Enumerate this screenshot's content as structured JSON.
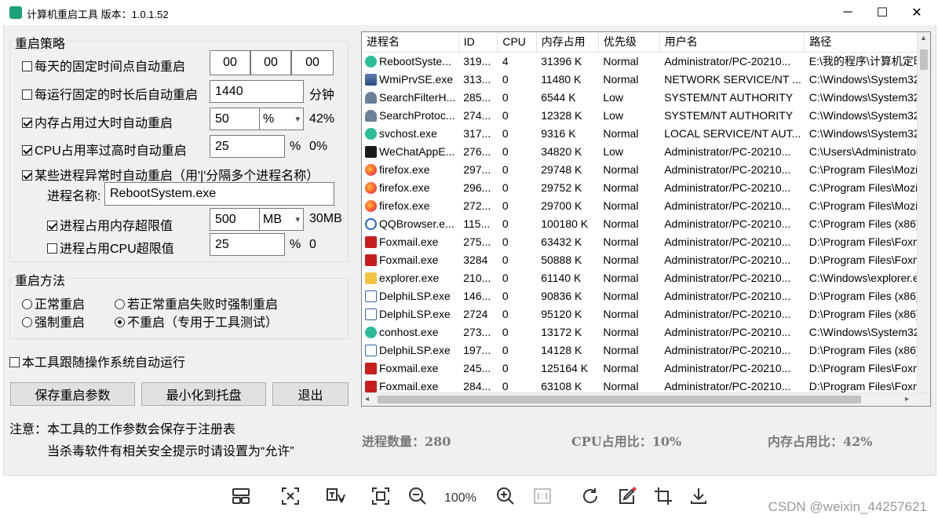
{
  "window": {
    "title": "计算机重启工具 版本：1.0.1.52",
    "minimize": "─",
    "maximize": "☐",
    "close": "✕"
  },
  "strategy": {
    "title": "重启策略",
    "fixed_time": {
      "label": "每天的固定时间点自动重启",
      "checked": false,
      "h": "00",
      "m": "00",
      "s": "00"
    },
    "run_duration": {
      "label": "每运行固定的时长后自动重启",
      "checked": false,
      "value": "1440",
      "unit": "分钟"
    },
    "memory": {
      "label": "内存占用过大时自动重启",
      "checked": true,
      "value": "50",
      "unit": "%",
      "current": "42%"
    },
    "cpu": {
      "label": "CPU占用率过高时自动重启",
      "checked": true,
      "value": "25",
      "unit": "%",
      "current": "0%"
    },
    "process": {
      "label": "某些进程异常时自动重启（用'|'分隔多个进程名称）",
      "checked": true,
      "name_label": "进程名称:",
      "name_value": "RebootSystem.exe",
      "mem_limit": {
        "label": "进程占用内存超限值",
        "checked": true,
        "value": "500",
        "unit": "MB",
        "current": "30MB"
      },
      "cpu_limit": {
        "label": "进程占用CPU超限值",
        "checked": false,
        "value": "25",
        "unit": "%",
        "current": "0"
      }
    }
  },
  "method": {
    "title": "重启方法",
    "normal": "正常重启",
    "force_if_fail": "若正常重启失败时强制重启",
    "force": "强制重启",
    "no_restart": "不重启（专用于工具测试）",
    "selected": "no_restart"
  },
  "autostart": {
    "label": "本工具跟随操作系统自动运行",
    "checked": false
  },
  "buttons": {
    "save": "保存重启参数",
    "minimize_tray": "最小化到托盘",
    "exit": "退出"
  },
  "notes": {
    "line1": "注意：本工具的工作参数会保存于注册表",
    "line2": "当杀毒软件有相关安全提示时请设置为“允许”"
  },
  "table": {
    "columns": [
      "进程名",
      "ID",
      "CPU",
      "内存占用",
      "优先级",
      "用户名",
      "路径"
    ],
    "rows": [
      {
        "icon": "green",
        "name": "RebootSyste...",
        "id": "319...",
        "cpu": "4",
        "mem": "31396 K",
        "prio": "Normal",
        "user": "Administrator/PC-20210...",
        "path": "E:\\我的程序\\计算机定时"
      },
      {
        "icon": "wmi",
        "name": "WmiPrvSE.exe",
        "id": "313...",
        "cpu": "0",
        "mem": "11480 K",
        "prio": "Normal",
        "user": "NETWORK SERVICE/NT ...",
        "path": "C:\\Windows\\System32"
      },
      {
        "icon": "person",
        "name": "SearchFilterH...",
        "id": "285...",
        "cpu": "0",
        "mem": "6544 K",
        "prio": "Low",
        "user": "SYSTEM/NT AUTHORITY",
        "path": "C:\\Windows\\System32"
      },
      {
        "icon": "person",
        "name": "SearchProtoc...",
        "id": "274...",
        "cpu": "0",
        "mem": "12328 K",
        "prio": "Low",
        "user": "SYSTEM/NT AUTHORITY",
        "path": "C:\\Windows\\System32"
      },
      {
        "icon": "green",
        "name": "svchost.exe",
        "id": "317...",
        "cpu": "0",
        "mem": "9316 K",
        "prio": "Normal",
        "user": "LOCAL SERVICE/NT AUT...",
        "path": "C:\\Windows\\System32"
      },
      {
        "icon": "wechat",
        "name": "WeChatAppE...",
        "id": "276...",
        "cpu": "0",
        "mem": "34820 K",
        "prio": "Low",
        "user": "Administrator/PC-20210...",
        "path": "C:\\Users\\Administrator"
      },
      {
        "icon": "firefox",
        "name": "firefox.exe",
        "id": "297...",
        "cpu": "0",
        "mem": "29748 K",
        "prio": "Normal",
        "user": "Administrator/PC-20210...",
        "path": "C:\\Program Files\\Mozil"
      },
      {
        "icon": "firefox",
        "name": "firefox.exe",
        "id": "296...",
        "cpu": "0",
        "mem": "29752 K",
        "prio": "Normal",
        "user": "Administrator/PC-20210...",
        "path": "C:\\Program Files\\Mozil"
      },
      {
        "icon": "firefox",
        "name": "firefox.exe",
        "id": "272...",
        "cpu": "0",
        "mem": "29700 K",
        "prio": "Normal",
        "user": "Administrator/PC-20210...",
        "path": "C:\\Program Files\\Mozil"
      },
      {
        "icon": "qq",
        "name": "QQBrowser.e...",
        "id": "115...",
        "cpu": "0",
        "mem": "100180 K",
        "prio": "Normal",
        "user": "Administrator/PC-20210...",
        "path": "C:\\Program Files (x86)\\"
      },
      {
        "icon": "foxmail",
        "name": "Foxmail.exe",
        "id": "275...",
        "cpu": "0",
        "mem": "63432 K",
        "prio": "Normal",
        "user": "Administrator/PC-20210...",
        "path": "D:\\Program Files\\Foxm"
      },
      {
        "icon": "foxmail",
        "name": "Foxmail.exe",
        "id": "3284",
        "cpu": "0",
        "mem": "50888 K",
        "prio": "Normal",
        "user": "Administrator/PC-20210...",
        "path": "D:\\Program Files\\Foxm"
      },
      {
        "icon": "folder",
        "name": "explorer.exe",
        "id": "210...",
        "cpu": "0",
        "mem": "61140 K",
        "prio": "Normal",
        "user": "Administrator/PC-20210...",
        "path": "C:\\Windows\\explorer.e"
      },
      {
        "icon": "delphi",
        "name": "DelphiLSP.exe",
        "id": "146...",
        "cpu": "0",
        "mem": "90836 K",
        "prio": "Normal",
        "user": "Administrator/PC-20210...",
        "path": "D:\\Program Files (x86)\\"
      },
      {
        "icon": "delphi",
        "name": "DelphiLSP.exe",
        "id": "2724",
        "cpu": "0",
        "mem": "95120 K",
        "prio": "Normal",
        "user": "Administrator/PC-20210...",
        "path": "D:\\Program Files (x86)\\"
      },
      {
        "icon": "green",
        "name": "conhost.exe",
        "id": "273...",
        "cpu": "0",
        "mem": "13172 K",
        "prio": "Normal",
        "user": "Administrator/PC-20210...",
        "path": "C:\\Windows\\System32"
      },
      {
        "icon": "delphi",
        "name": "DelphiLSP.exe",
        "id": "197...",
        "cpu": "0",
        "mem": "14128 K",
        "prio": "Normal",
        "user": "Administrator/PC-20210...",
        "path": "D:\\Program Files (x86)\\"
      },
      {
        "icon": "foxmail",
        "name": "Foxmail.exe",
        "id": "245...",
        "cpu": "0",
        "mem": "125164 K",
        "prio": "Normal",
        "user": "Administrator/PC-20210...",
        "path": "D:\\Program Files\\Foxm"
      },
      {
        "icon": "foxmail",
        "name": "Foxmail.exe",
        "id": "284...",
        "cpu": "0",
        "mem": "63108 K",
        "prio": "Normal",
        "user": "Administrator/PC-20210...",
        "path": "D:\\Program Files\\Foxm"
      }
    ]
  },
  "stats": {
    "process_count": "进程数量：280",
    "cpu_usage": "CPU占用比：10%",
    "mem_usage": "内存占用比：42%"
  },
  "viewer": {
    "zoom": "100%"
  },
  "watermark": "CSDN @weixin_44257621"
}
